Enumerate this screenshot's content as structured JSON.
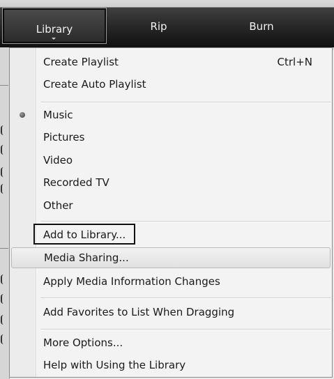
{
  "toolbar": {
    "tabs": {
      "library": "Library",
      "rip": "Rip",
      "burn": "Burn"
    }
  },
  "menu": {
    "create_playlist": {
      "label": "Create Playlist",
      "shortcut": "Ctrl+N"
    },
    "create_auto_playlist": {
      "label": "Create Auto Playlist"
    },
    "music": {
      "label": "Music",
      "selected": true
    },
    "pictures": {
      "label": "Pictures"
    },
    "video": {
      "label": "Video"
    },
    "recorded_tv": {
      "label": "Recorded TV"
    },
    "other": {
      "label": "Other"
    },
    "add_to_library": {
      "label": "Add to Library..."
    },
    "media_sharing": {
      "label": "Media Sharing..."
    },
    "apply_media_info": {
      "label": "Apply Media Information Changes"
    },
    "add_favorites": {
      "label": "Add Favorites to List When Dragging"
    },
    "more_options": {
      "label": "More Options..."
    },
    "help_library": {
      "label": "Help with Using the Library"
    }
  }
}
